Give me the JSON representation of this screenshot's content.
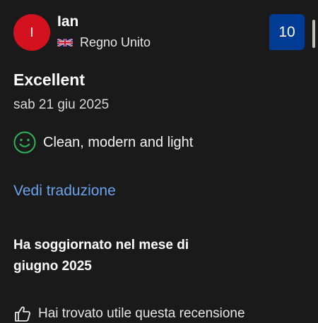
{
  "reviewer": {
    "initial": "I",
    "name": "Ian",
    "country": "Regno Unito",
    "avatar_color": "#d4111e"
  },
  "score": {
    "value": "10",
    "badge_color": "#003b95"
  },
  "review": {
    "title": "Excellent",
    "date": "sab 21 giu 2025",
    "positive": "Clean, modern and light"
  },
  "translate_label": "Vedi traduzione",
  "stay": {
    "line1": "Ha soggiornato nel mese di",
    "line2": "giugno 2025"
  },
  "helpful_label": "Hai trovato utile questa recensione",
  "colors": {
    "background": "#1a1a1a",
    "link": "#6aa3ee",
    "positive_icon": "#2fb35a"
  },
  "icons": {
    "flag": "uk-flag-icon",
    "positive": "smiley-icon",
    "helpful": "thumbs-up-icon"
  }
}
